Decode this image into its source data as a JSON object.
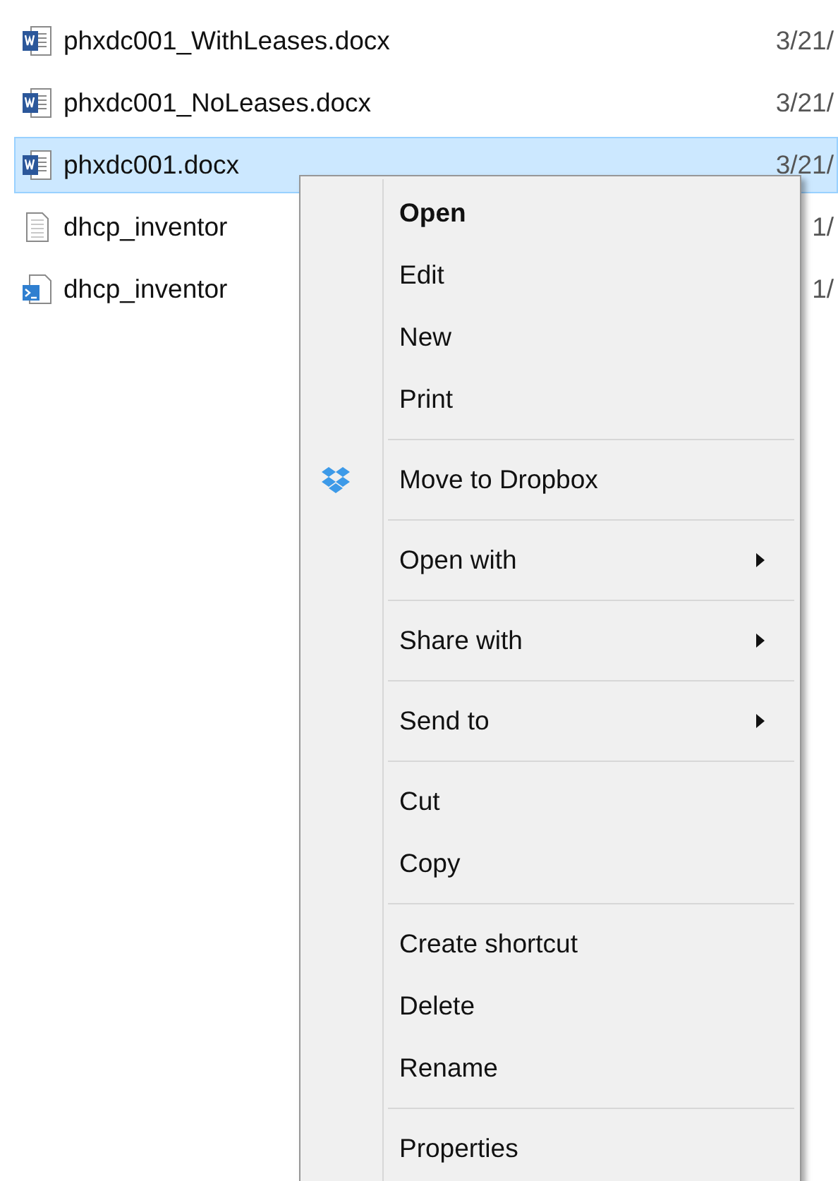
{
  "files": [
    {
      "name": "phxdc001_WithLeases.docx",
      "date": "3/21/",
      "kind": "word",
      "selected": false
    },
    {
      "name": "phxdc001_NoLeases.docx",
      "date": "3/21/",
      "kind": "word",
      "selected": false
    },
    {
      "name": "phxdc001.docx",
      "date": "3/21/",
      "kind": "word",
      "selected": true
    },
    {
      "name": "dhcp_inventor",
      "date": "1/",
      "kind": "text",
      "selected": false
    },
    {
      "name": "dhcp_inventor",
      "date": "1/",
      "kind": "script",
      "selected": false
    }
  ],
  "context_menu": [
    {
      "kind": "item",
      "label": "Open",
      "default": true
    },
    {
      "kind": "item",
      "label": "Edit",
      "default": false
    },
    {
      "kind": "item",
      "label": "New",
      "default": false
    },
    {
      "kind": "item",
      "label": "Print",
      "default": false
    },
    {
      "kind": "separator"
    },
    {
      "kind": "item",
      "label": "Move to Dropbox",
      "default": false,
      "has_icon": true
    },
    {
      "kind": "separator"
    },
    {
      "kind": "item",
      "label": "Open with",
      "default": false,
      "submenu": true
    },
    {
      "kind": "separator"
    },
    {
      "kind": "item",
      "label": "Share with",
      "default": false,
      "submenu": true
    },
    {
      "kind": "separator"
    },
    {
      "kind": "item",
      "label": "Send to",
      "default": false,
      "submenu": true
    },
    {
      "kind": "separator"
    },
    {
      "kind": "item",
      "label": "Cut",
      "default": false
    },
    {
      "kind": "item",
      "label": "Copy",
      "default": false
    },
    {
      "kind": "separator"
    },
    {
      "kind": "item",
      "label": "Create shortcut",
      "default": false
    },
    {
      "kind": "item",
      "label": "Delete",
      "default": false
    },
    {
      "kind": "item",
      "label": "Rename",
      "default": false
    },
    {
      "kind": "separator"
    },
    {
      "kind": "item",
      "label": "Properties",
      "default": false
    }
  ]
}
